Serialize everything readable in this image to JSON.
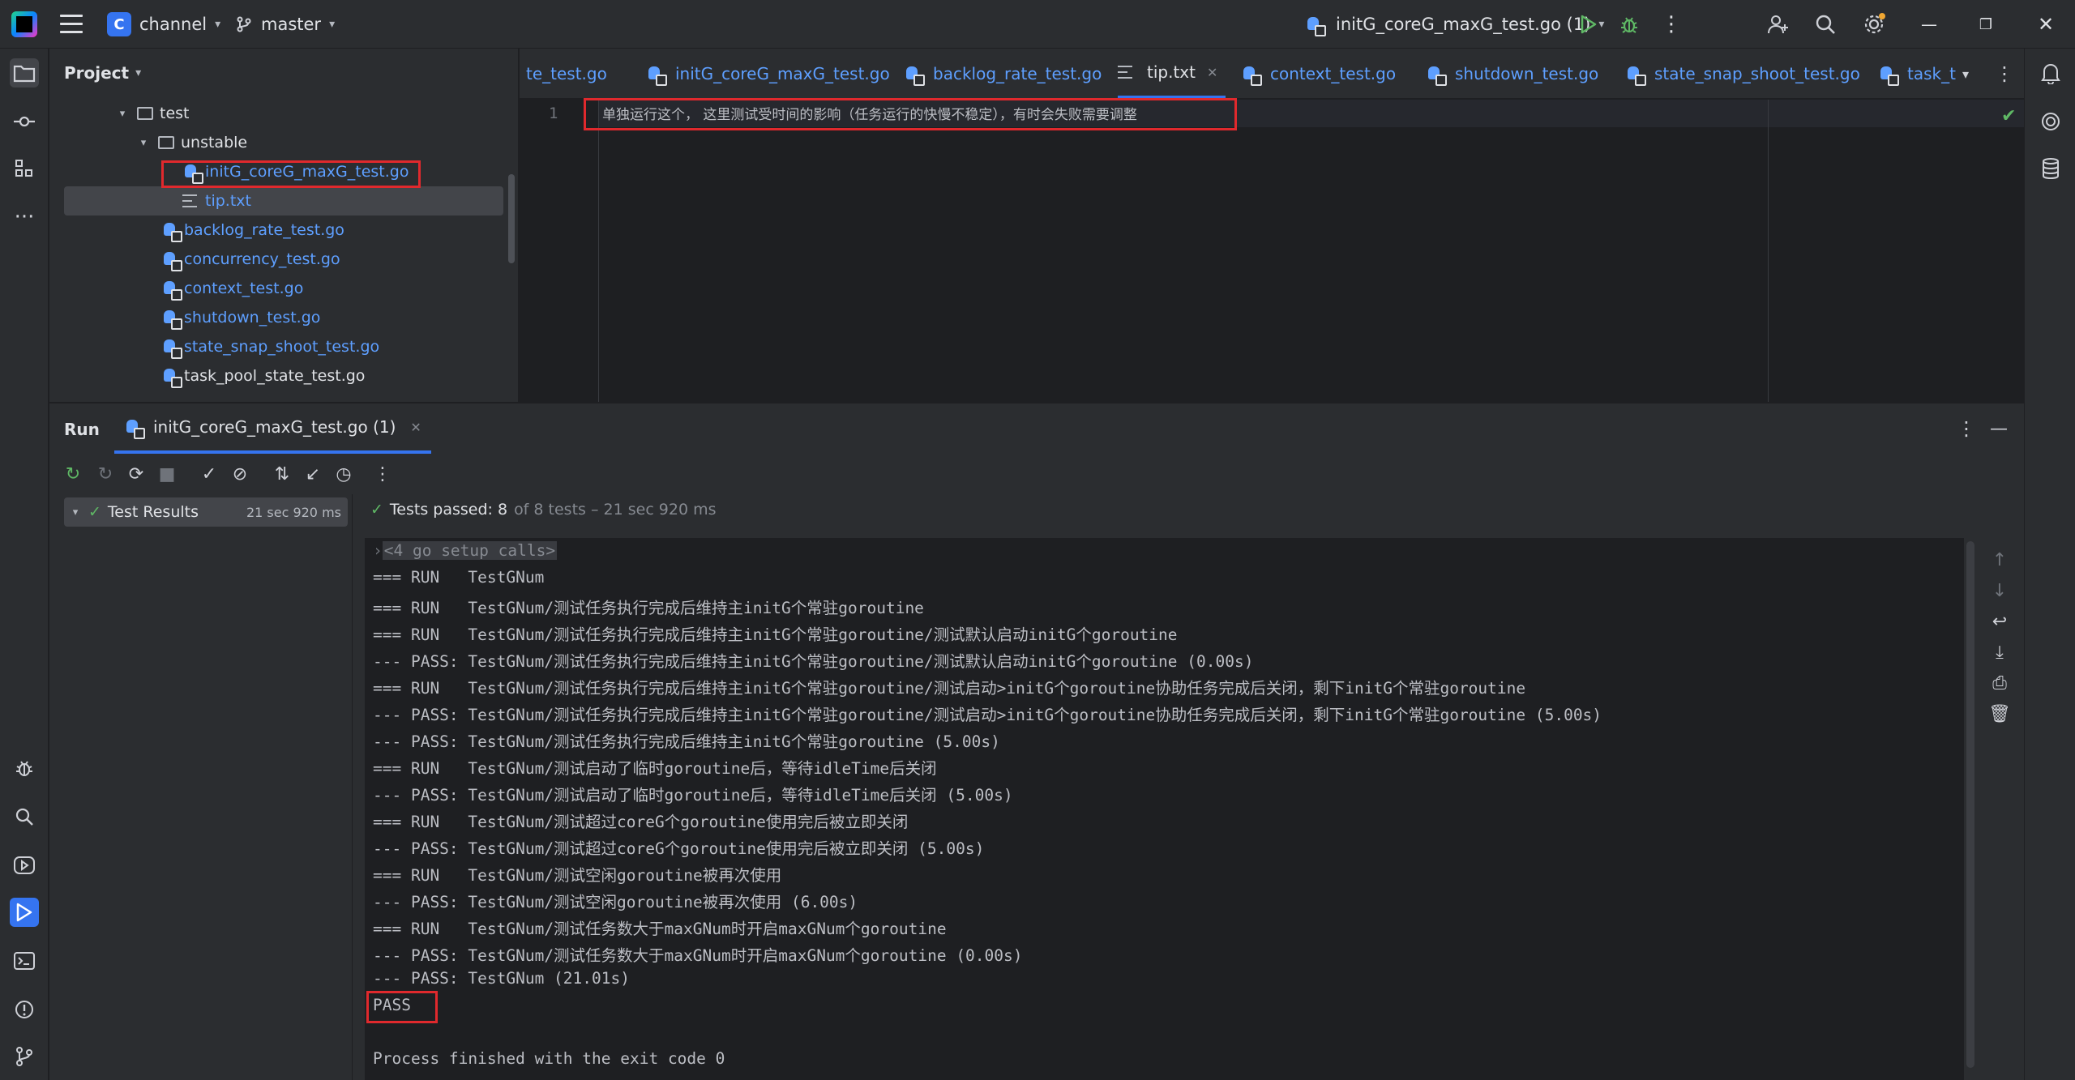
{
  "titlebar": {
    "project_letter": "C",
    "project_name": "channel",
    "branch": "master",
    "run_config": "initG_coreG_maxG_test.go (1)"
  },
  "project_panel": {
    "title": "Project",
    "tree": [
      {
        "label": "test",
        "kind": "folder",
        "depth": 1
      },
      {
        "label": "unstable",
        "kind": "folder",
        "depth": 2
      },
      {
        "label": "initG_coreG_maxG_test.go",
        "kind": "go",
        "depth": 3
      },
      {
        "label": "tip.txt",
        "kind": "txt",
        "depth": 3
      },
      {
        "label": "backlog_rate_test.go",
        "kind": "go",
        "depth": 2
      },
      {
        "label": "concurrency_test.go",
        "kind": "go",
        "depth": 2
      },
      {
        "label": "context_test.go",
        "kind": "go",
        "depth": 2
      },
      {
        "label": "shutdown_test.go",
        "kind": "go",
        "depth": 2
      },
      {
        "label": "state_snap_shoot_test.go",
        "kind": "go",
        "depth": 2
      },
      {
        "label": "task_pool_state_test.go",
        "kind": "go",
        "depth": 2
      }
    ]
  },
  "editor_tabs": [
    {
      "label": "te_test.go"
    },
    {
      "label": "initG_coreG_maxG_test.go"
    },
    {
      "label": "backlog_rate_test.go"
    },
    {
      "label": "tip.txt",
      "active": true
    },
    {
      "label": "context_test.go"
    },
    {
      "label": "shutdown_test.go"
    },
    {
      "label": "state_snap_shoot_test.go"
    },
    {
      "label": "task_t"
    }
  ],
  "editor": {
    "line_number": "1",
    "line_text": "单独运行这个， 这里测试受时间的影响（任务运行的快慢不稳定），有时会失败需要调整"
  },
  "run_panel": {
    "title": "Run",
    "tab_label": "initG_coreG_maxG_test.go (1)",
    "results_label": "Test Results",
    "results_time": "21 sec 920 ms",
    "status_passed": "Tests passed: 8",
    "status_rest": "of 8 tests – 21 sec 920 ms",
    "console_lines": [
      "<4 go setup calls>",
      "=== RUN   TestGNum",
      "=== RUN   TestGNum/测试任务执行完成后维持主initG个常驻goroutine",
      "=== RUN   TestGNum/测试任务执行完成后维持主initG个常驻goroutine/测试默认启动initG个goroutine",
      "--- PASS: TestGNum/测试任务执行完成后维持主initG个常驻goroutine/测试默认启动initG个goroutine (0.00s)",
      "=== RUN   TestGNum/测试任务执行完成后维持主initG个常驻goroutine/测试启动>initG个goroutine协助任务完成后关闭，剩下initG个常驻goroutine",
      "--- PASS: TestGNum/测试任务执行完成后维持主initG个常驻goroutine/测试启动>initG个goroutine协助任务完成后关闭，剩下initG个常驻goroutine (5.00s)",
      "--- PASS: TestGNum/测试任务执行完成后维持主initG个常驻goroutine (5.00s)",
      "=== RUN   TestGNum/测试启动了临时goroutine后，等待idleTime后关闭",
      "--- PASS: TestGNum/测试启动了临时goroutine后，等待idleTime后关闭 (5.00s)",
      "=== RUN   TestGNum/测试超过coreG个goroutine使用完后被立即关闭",
      "--- PASS: TestGNum/测试超过coreG个goroutine使用完后被立即关闭 (5.00s)",
      "=== RUN   TestGNum/测试空闲goroutine被再次使用",
      "--- PASS: TestGNum/测试空闲goroutine被再次使用 (6.00s)",
      "=== RUN   TestGNum/测试任务数大于maxGNum时开启maxGNum个goroutine",
      "--- PASS: TestGNum/测试任务数大于maxGNum时开启maxGNum个goroutine (0.00s)",
      "--- PASS: TestGNum (21.01s)",
      "PASS",
      "",
      "Process finished with the exit code 0"
    ]
  },
  "colors": {
    "accent": "#3574f0",
    "highlight_box": "#e0292d",
    "pass_green": "#5fb865",
    "go_file_blue": "#5e9fff",
    "vcs_added_green": "#6aab73"
  }
}
